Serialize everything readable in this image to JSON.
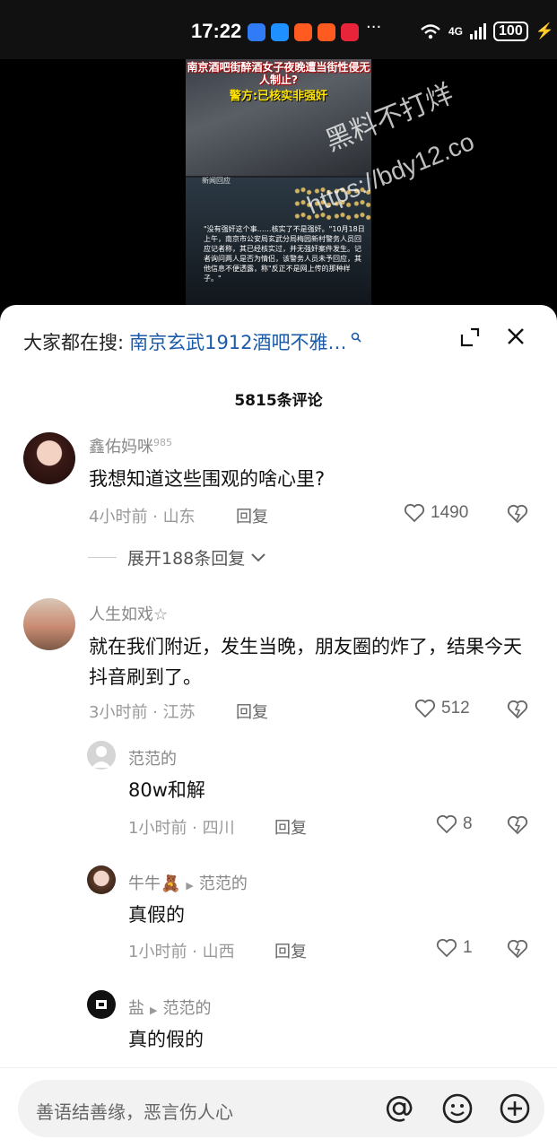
{
  "status": {
    "time": "17:22",
    "network": "4G",
    "battery": "100"
  },
  "video": {
    "poster_title": "南京酒吧街醉酒女子夜晚遭当街性侵无人制止?",
    "poster_sub": "警方:已核实非强奸",
    "poster_weibo": "新闻回应",
    "poster_caption": "\"没有强奸这个事……核实了不是强奸。\"10月18日上午，南京市公安局玄武分局梅园新村警务人员回应记者称，其已经核实过，并无强奸案件发生。记者询问两人是否为情侣，该警务人员未予回应，其他信息不便透露，称\"反正不是网上传的那种样子。\"",
    "watermark_line1": "黑料不打烊",
    "watermark_line2": "https://bdy12.co"
  },
  "sheet": {
    "search_prefix": "大家都在搜:",
    "search_query": "南京玄武1912酒吧不雅…",
    "comment_count": "5815条评论"
  },
  "comments": [
    {
      "user": "鑫佑妈咪",
      "user_badge": "985",
      "text": "我想知道这些围观的啥心里?",
      "meta": "4小时前 · 山东",
      "reply_label": "回复",
      "likes": "1490",
      "expand_label": "展开188条回复"
    },
    {
      "user": "人生如戏☆",
      "text": "就在我们附近，发生当晚，朋友圈的炸了，结果今天抖音刷到了。",
      "meta": "3小时前 · 江苏",
      "reply_label": "回复",
      "likes": "512"
    }
  ],
  "replies": [
    {
      "user": "范范的",
      "reply_to": "",
      "text": "80w和解",
      "meta": "1小时前 · 四川",
      "reply_label": "回复",
      "likes": "8"
    },
    {
      "user": "牛牛🧸",
      "reply_to": "范范的",
      "text": "真假的",
      "meta": "1小时前 · 山西",
      "reply_label": "回复",
      "likes": "1"
    },
    {
      "user": "盐",
      "reply_to": "范范的",
      "text": "真的假的"
    }
  ],
  "input": {
    "placeholder": "善语结善缘，恶言伤人心"
  },
  "colors": {
    "link": "#1a5aa8",
    "text": "#111111",
    "muted": "#999999"
  }
}
